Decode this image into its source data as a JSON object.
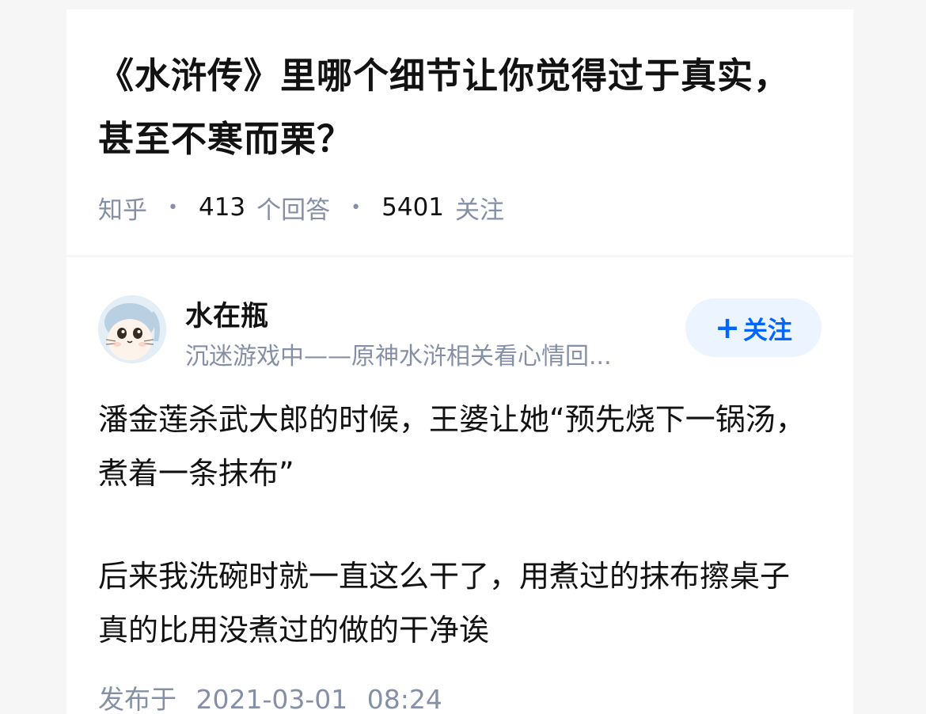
{
  "question": {
    "title": "《水浒传》里哪个细节让你觉得过于真实，甚至不寒而栗？",
    "source": "知乎",
    "answer_count": "413",
    "answer_label": "个回答",
    "follow_count": "5401",
    "follow_label": "关注"
  },
  "answer": {
    "author": {
      "name": "水在瓶",
      "bio": "沉迷游戏中——原神水浒相关看心情回...",
      "avatar_icon": "cat-avatar-icon"
    },
    "follow_button": {
      "icon": "+",
      "label": "关注"
    },
    "paragraphs": [
      "潘金莲杀武大郎的时候，王婆让她“预先烧下一锅汤，煮着一条抹布”",
      "后来我洗碗时就一直这么干了，用煮过的抹布擦桌子真的比用没煮过的做的干净诶"
    ],
    "publish_prefix": "发布于",
    "publish_date": "2021-03-01",
    "publish_time": "08:24"
  },
  "colors": {
    "background": "#f6f6f6",
    "card": "#ffffff",
    "primary_text": "#121212",
    "secondary_text": "#8590a6",
    "accent": "#0066ff",
    "follow_button_bg": "#ebf4ff"
  }
}
